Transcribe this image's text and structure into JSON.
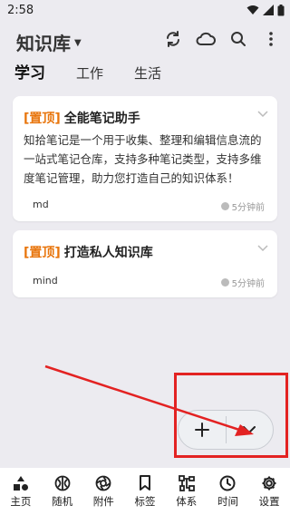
{
  "status_bar": {
    "time": "2:58"
  },
  "app_bar": {
    "title": "知识库",
    "actions": [
      "sync-icon",
      "cloud-icon",
      "search-icon",
      "more-icon"
    ]
  },
  "tabs": [
    {
      "label": "学习",
      "active": true
    },
    {
      "label": "工作",
      "active": false
    },
    {
      "label": "生活",
      "active": false
    }
  ],
  "notes": [
    {
      "pin_label": "[置顶]",
      "title": "全能笔记助手",
      "body": "知拾笔记是一个用于收集、整理和编辑信息流的一站式笔记仓库，支持多种笔记类型，支持多维度笔记管理，助力您打造自己的知识体系！",
      "tag": "md",
      "time": "5分钟前"
    },
    {
      "pin_label": "[置顶]",
      "title": "打造私人知识库",
      "body": "",
      "tag": "mind",
      "time": "5分钟前"
    }
  ],
  "fab": {
    "add_icon": "plus-icon",
    "expand_icon": "chevron-down-icon"
  },
  "bottom_nav": [
    {
      "label": "主页",
      "icon": "home-shapes-icon"
    },
    {
      "label": "随机",
      "icon": "random-icon"
    },
    {
      "label": "附件",
      "icon": "aperture-icon"
    },
    {
      "label": "标签",
      "icon": "bookmark-icon"
    },
    {
      "label": "体系",
      "icon": "hierarchy-icon"
    },
    {
      "label": "时间",
      "icon": "clock-icon"
    },
    {
      "label": "设置",
      "icon": "gear-icon"
    }
  ],
  "colors": {
    "pin": "#e8750c",
    "annotation": "#e32222",
    "background": "#ecebf0"
  }
}
